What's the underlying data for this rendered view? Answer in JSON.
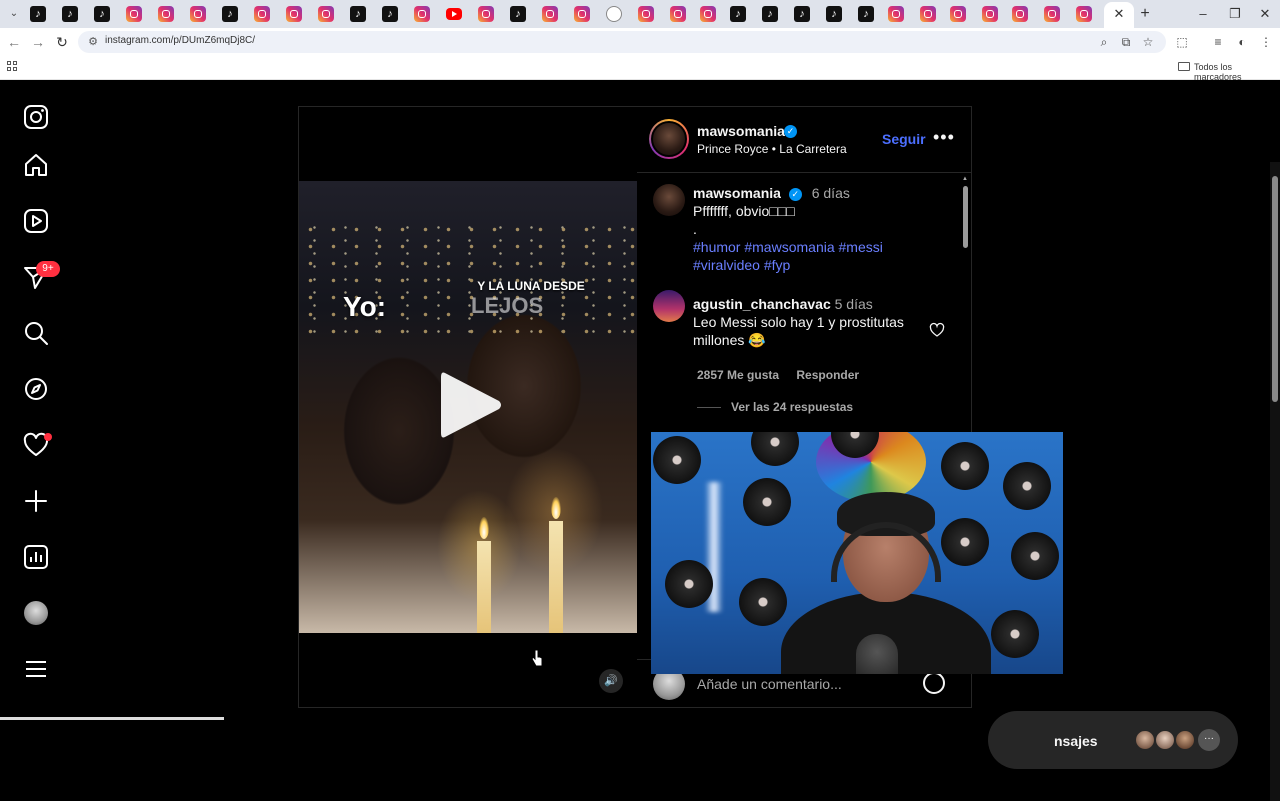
{
  "browser": {
    "url": "instagram.com/p/DUmZ6mqDj8C/",
    "bookmarks_label": "Todos los marcadores",
    "close_tab_label": "✕",
    "new_tab_label": "+"
  },
  "nav": {
    "notifications_badge": "9+"
  },
  "post": {
    "author": "mawsomania",
    "audio_artist": "Prince Royce",
    "audio_separator": "•",
    "audio_track": "La Carretera",
    "follow_label": "Seguir",
    "more_label": "•••",
    "meme_top_left": "Yo:",
    "meme_top_right": "Y LA LUNA DESDE",
    "meme_top_right_2": "LEJOS"
  },
  "caption": {
    "author": "mawsomania",
    "time": "6 días",
    "text": "Pfffffff, obvio□□□",
    "dot": ".",
    "hashtags_line1": "#humor #mawsomania #messi",
    "hashtags_line2": "#viralvideo #fyp"
  },
  "comments": [
    {
      "author": "agustin_chanchavac",
      "time": "5 días",
      "text": "Leo Messi solo hay 1 y prostitutas millones 😂",
      "likes": "2857 Me gusta",
      "reply_label": "Responder",
      "view_replies": "Ver las 24 respuestas"
    }
  ],
  "add_comment": {
    "placeholder": "Añade un comentario..."
  },
  "messages": {
    "label": "nsajes",
    "more": "···"
  },
  "colors": {
    "link_blue": "#4c6fff",
    "hashtag": "#6a7fff",
    "badge_red": "#ff3040",
    "verified": "#0095f6"
  }
}
